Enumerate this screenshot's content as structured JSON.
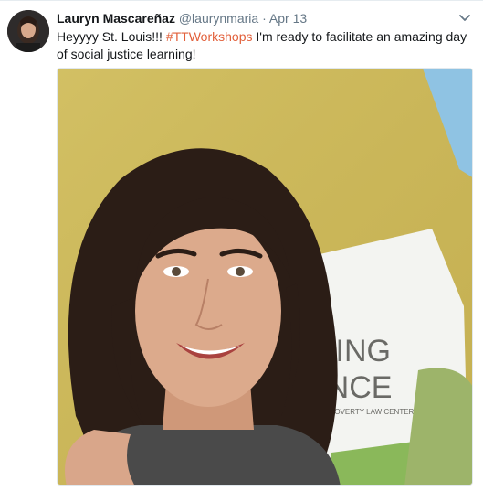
{
  "tweet": {
    "author_name": "Lauryn Mascareñaz",
    "handle": "@laurynmaria",
    "separator": "·",
    "timestamp": "Apr 13",
    "text_before": "Heyyyy St. Louis!!! ",
    "hashtag": "#TTWorkshops",
    "text_after": " I'm ready to facilitate an amazing day of social justice learning!",
    "photo_banner": {
      "line1": "HING",
      "line2": "ANCE",
      "line3": "N POVERTY LAW CENTER"
    }
  },
  "colors": {
    "hashtag": "#e2603b",
    "meta_text": "#657786",
    "wall": "#cdb85a",
    "banner": "#f3f4f1"
  },
  "icons": {
    "caret": "chevron-down-icon"
  }
}
